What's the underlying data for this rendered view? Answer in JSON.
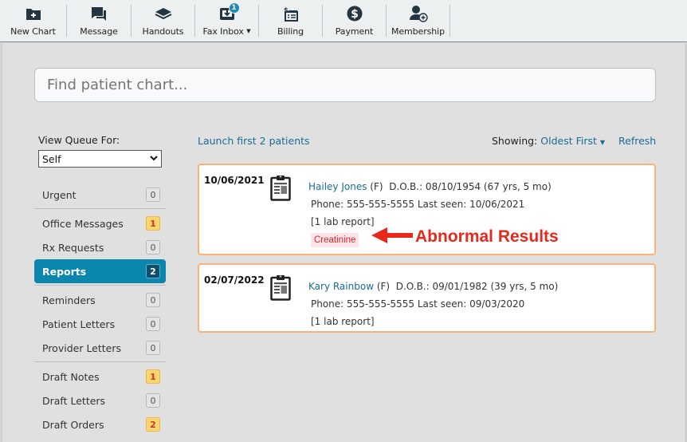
{
  "toolbar": {
    "items": [
      {
        "label": "New Chart",
        "icon": "folder-plus-icon"
      },
      {
        "label": "Message",
        "icon": "chat-bubbles-icon"
      },
      {
        "label": "Handouts",
        "icon": "book-icon"
      },
      {
        "label": "Fax Inbox",
        "icon": "inbox-download-icon",
        "badge": "1",
        "has_caret": true
      },
      {
        "label": "Billing",
        "icon": "billing-list-icon"
      },
      {
        "label": "Payment",
        "icon": "dollar-circle-icon"
      },
      {
        "label": "Membership",
        "icon": "user-plus-icon"
      }
    ]
  },
  "search": {
    "placeholder": "Find patient chart..."
  },
  "sidebar": {
    "view_queue_label": "View Queue For:",
    "view_queue_value": "Self",
    "groups": [
      [
        {
          "label": "Urgent",
          "count": "0",
          "style": "neutral"
        }
      ],
      [
        {
          "label": "Office Messages",
          "count": "1",
          "style": "warn"
        },
        {
          "label": "Rx Requests",
          "count": "0",
          "style": "neutral"
        },
        {
          "label": "Reports",
          "count": "2",
          "style": "active",
          "active": true
        }
      ],
      [
        {
          "label": "Reminders",
          "count": "0",
          "style": "neutral"
        },
        {
          "label": "Patient Letters",
          "count": "0",
          "style": "neutral"
        },
        {
          "label": "Provider Letters",
          "count": "0",
          "style": "neutral"
        }
      ],
      [
        {
          "label": "Draft Notes",
          "count": "1",
          "style": "warn"
        },
        {
          "label": "Draft Letters",
          "count": "0",
          "style": "neutral"
        },
        {
          "label": "Draft Orders",
          "count": "2",
          "style": "warn"
        }
      ]
    ]
  },
  "main": {
    "launch_label": "Launch first 2 patients",
    "showing_label": "Showing:",
    "showing_value": "Oldest First",
    "refresh_label": "Refresh",
    "patients": [
      {
        "date": "10/06/2021",
        "name": "Hailey Jones",
        "sex": "(F)",
        "dob": "D.O.B.: 08/10/1954 (67 yrs, 5 mo)",
        "phone_line": "Phone: 555-555-5555 Last seen: 10/06/2021",
        "reports": "[1 lab report]",
        "abnormal_tags": [
          "Creatinine"
        ]
      },
      {
        "date": "02/07/2022",
        "name": "Kary Rainbow",
        "sex": "(F)",
        "dob": "D.O.B.: 09/01/1982 (39 yrs, 5 mo)",
        "phone_line": "Phone: 555-555-5555 Last seen: 09/03/2020",
        "reports": "[1 lab report]",
        "abnormal_tags": []
      }
    ]
  },
  "annotation": {
    "text": "Abnormal Results",
    "color": "#e8281c"
  },
  "colors": {
    "accent": "#0b86ad",
    "link": "#1a6b96",
    "card_border": "#f8b37a",
    "warn_badge": "#fdd66b"
  }
}
